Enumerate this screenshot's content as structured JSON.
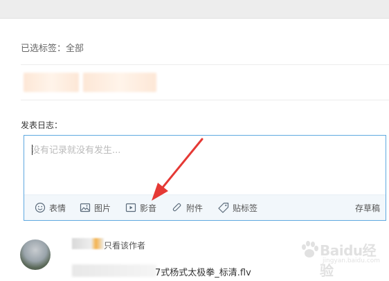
{
  "header": {
    "selected_tags": "已选标签：全部"
  },
  "compose": {
    "label": "发表日志：",
    "placeholder": "没有记录就没有发生..."
  },
  "toolbar": {
    "items": [
      {
        "label": "表情",
        "icon": "emoji-icon"
      },
      {
        "label": "图片",
        "icon": "image-icon"
      },
      {
        "label": "影音",
        "icon": "video-icon"
      },
      {
        "label": "附件",
        "icon": "paperclip-icon"
      },
      {
        "label": "贴标签",
        "icon": "tag-icon"
      }
    ],
    "save_draft": "存草稿"
  },
  "post": {
    "only_author": "只看该作者",
    "file_name": "7式杨式太极拳_标清.flv"
  },
  "watermark": {
    "brand": "Baidu经验",
    "url": "jingyan.baidu.com"
  },
  "colors": {
    "accent": "#5ea8e0",
    "annotation_arrow": "#e53935",
    "toolbar_bg": "#f2f7fb"
  }
}
